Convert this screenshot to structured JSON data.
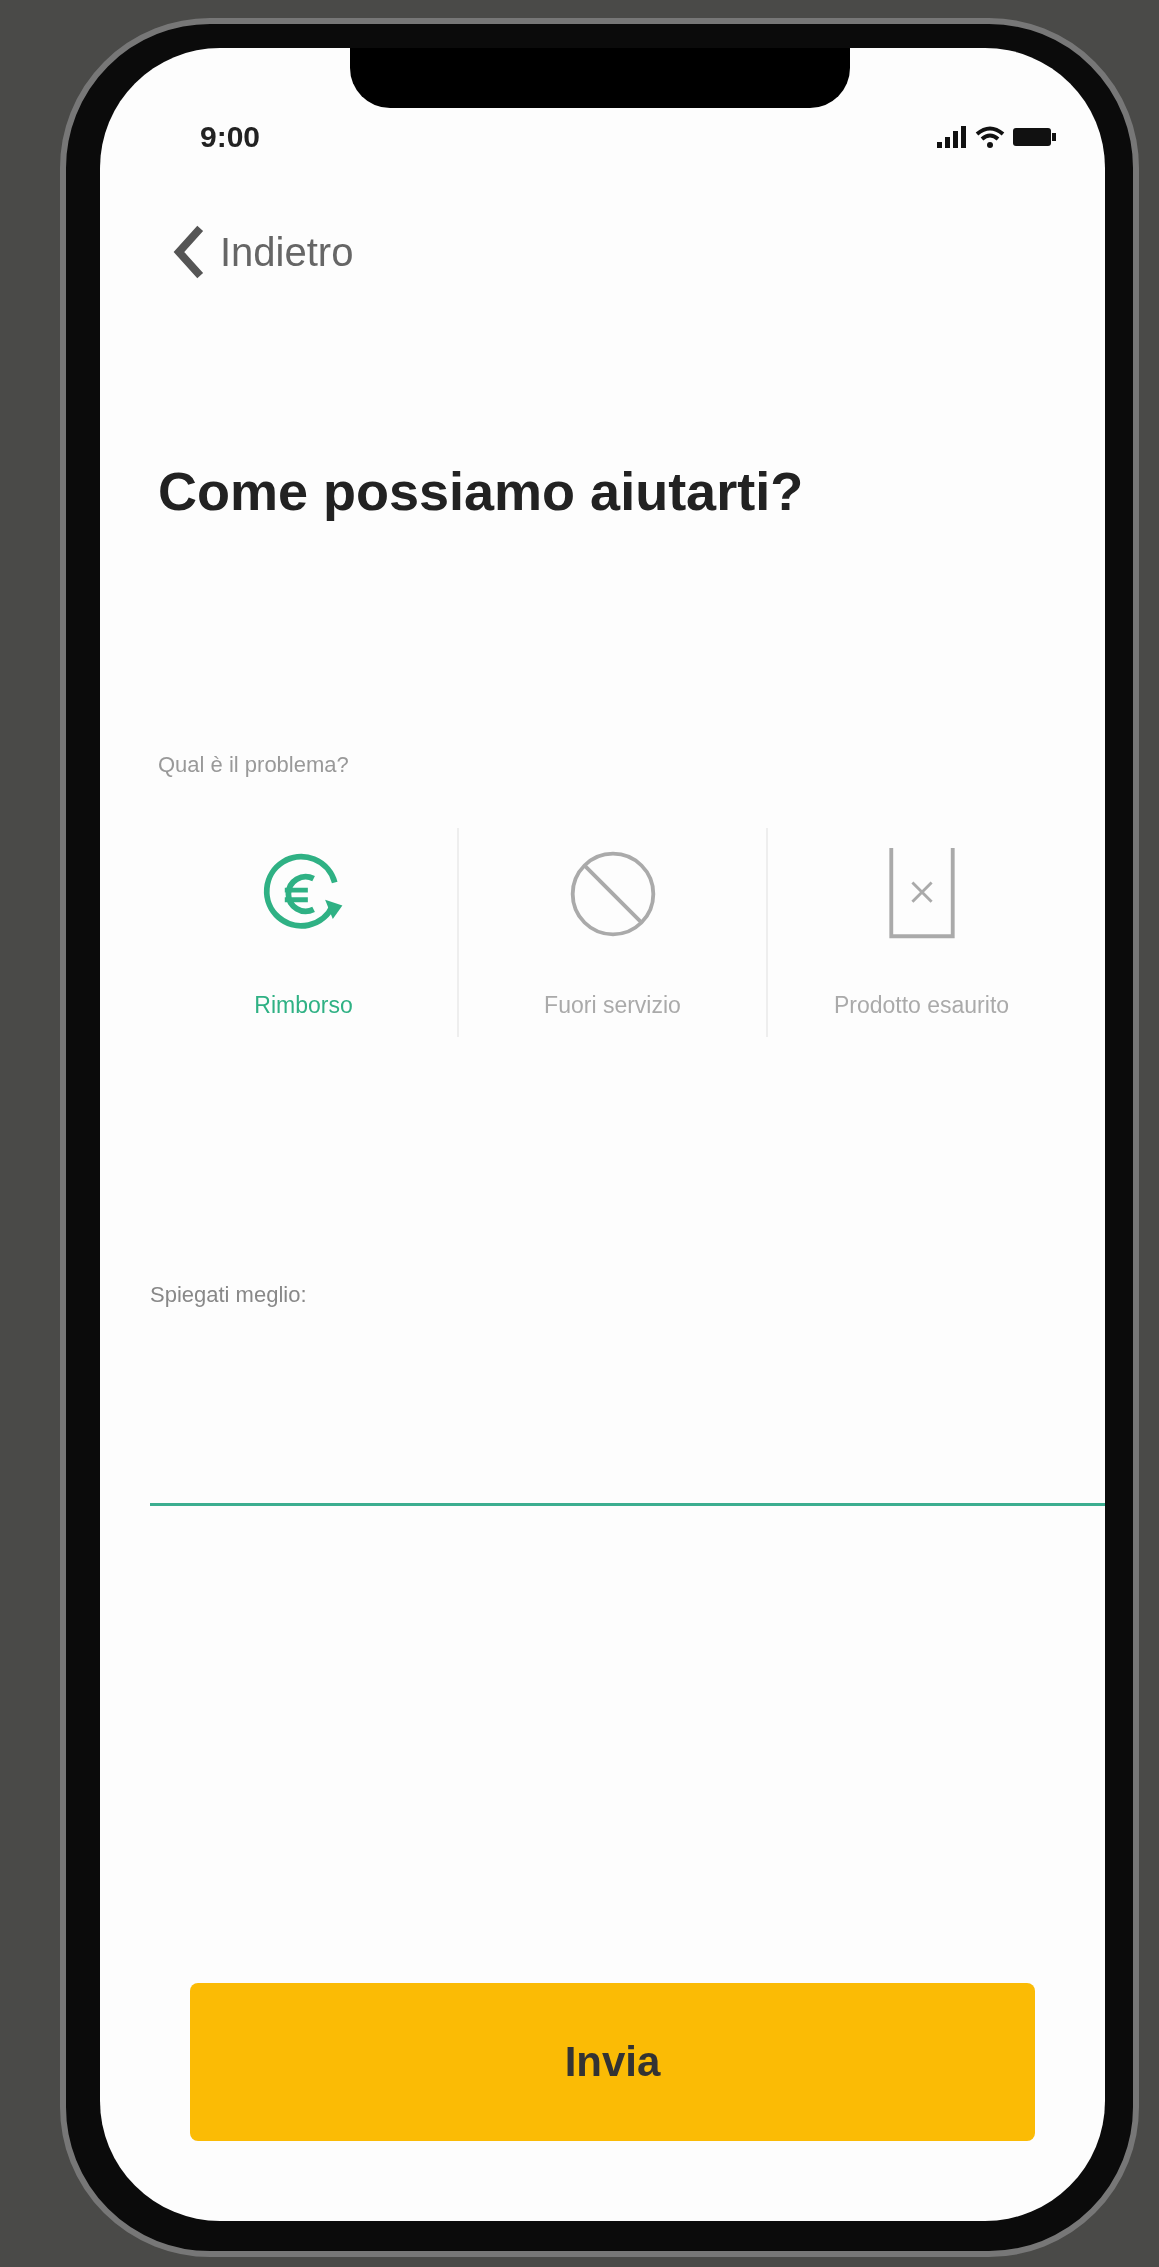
{
  "status_bar": {
    "time": "9:00"
  },
  "back": {
    "label": "Indietro"
  },
  "heading": "Come possiamo aiutarti?",
  "question": "Qual è il problema?",
  "options": [
    {
      "kind": "refund",
      "label": "Rimborso",
      "selected": true
    },
    {
      "kind": "blocked",
      "label": "Fuori servizio",
      "selected": false
    },
    {
      "kind": "empty",
      "label": "Prodotto esaurito",
      "selected": false
    }
  ],
  "details": {
    "label": "Spiegati meglio:"
  },
  "submit": "Invia"
}
